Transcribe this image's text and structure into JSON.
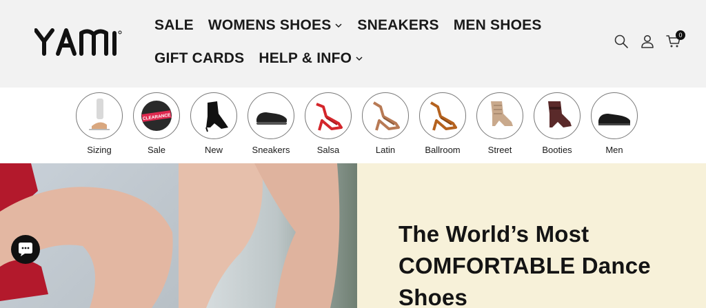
{
  "brand": {
    "logo_text": "YAMI"
  },
  "nav": {
    "row1": [
      {
        "label": "SALE",
        "dropdown": false
      },
      {
        "label": "WOMENS SHOES",
        "dropdown": true
      },
      {
        "label": "SNEAKERS",
        "dropdown": false
      },
      {
        "label": "MEN SHOES",
        "dropdown": false
      }
    ],
    "row2": [
      {
        "label": "GIFT CARDS",
        "dropdown": false
      },
      {
        "label": "HELP & INFO",
        "dropdown": true
      }
    ]
  },
  "header_icons": {
    "search": "search-icon",
    "account": "user-icon",
    "cart": "cart-icon",
    "cart_count": "0"
  },
  "categories": [
    {
      "label": "Sizing",
      "icon": "sizing-image"
    },
    {
      "label": "Sale",
      "icon": "clearance-badge-image",
      "badge_text": "CLEARANCE"
    },
    {
      "label": "New",
      "icon": "black-boot-image"
    },
    {
      "label": "Sneakers",
      "icon": "black-sneaker-image"
    },
    {
      "label": "Salsa",
      "icon": "red-heel-image"
    },
    {
      "label": "Latin",
      "icon": "tan-heel-image"
    },
    {
      "label": "Ballroom",
      "icon": "brown-heel-image"
    },
    {
      "label": "Street",
      "icon": "beige-bootie-image"
    },
    {
      "label": "Booties",
      "icon": "burgundy-bootie-image"
    },
    {
      "label": "Men",
      "icon": "mens-oxford-image"
    }
  ],
  "hero": {
    "title": "The World’s Most COMFORTABLE Dance Shoes"
  },
  "colors": {
    "header_bg": "#f2f2f2",
    "hero_panel_bg": "#f7f1d9",
    "text": "#1a1a1a",
    "chat_button": "#111111"
  }
}
